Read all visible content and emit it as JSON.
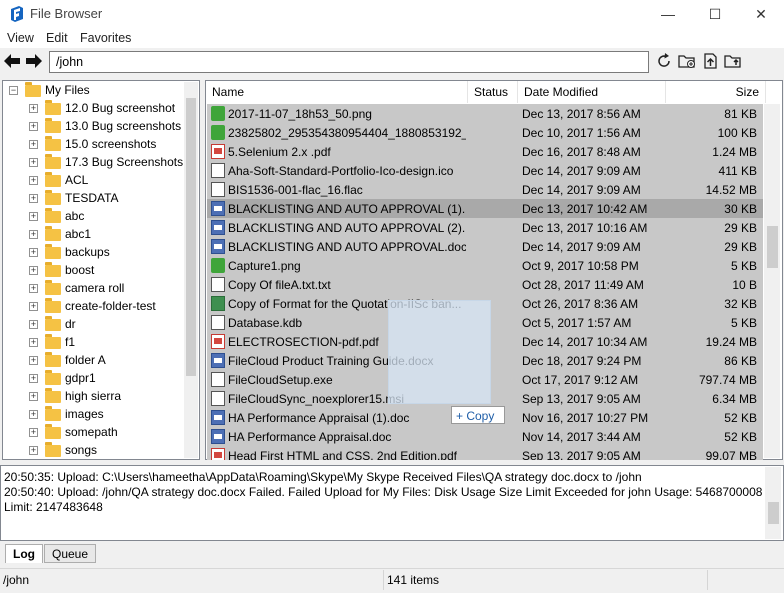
{
  "window": {
    "title": "File Browser",
    "minimize": "—",
    "maximize": "☐",
    "close": "✕"
  },
  "menu": [
    "View",
    "Edit",
    "Favorites"
  ],
  "toolbar": {
    "path_value": "/john",
    "back": "🡐",
    "forward": "🡒"
  },
  "tree": {
    "root": "My Files",
    "items": [
      "12.0 Bug screenshot",
      "13.0 Bug screenshots",
      "15.0 screenshots",
      "17.3 Bug Screenshots",
      "ACL",
      "TESDATA",
      "abc",
      "abc1",
      "backups",
      "boost",
      "camera roll",
      "create-folder-test",
      "dr",
      "f1",
      "folder A",
      "gdpr1",
      "high sierra",
      "images",
      "somepath",
      "songs"
    ]
  },
  "columns": {
    "name": "Name",
    "status": "Status",
    "date": "Date Modified",
    "size": "Size"
  },
  "files": [
    {
      "icon": "image-file-icon",
      "kind": "img",
      "name": "2017-11-07_18h53_50.png",
      "date": "Dec 13, 2017 8:56 AM",
      "size": "81 KB"
    },
    {
      "icon": "image-file-icon",
      "kind": "img",
      "name": "23825802_295354380954404_1880853192_o....",
      "date": "Dec 10, 2017 1:56 AM",
      "size": "100 KB"
    },
    {
      "icon": "pdf-file-icon",
      "kind": "pdf",
      "name": "5.Selenium 2.x .pdf",
      "date": "Dec 16, 2017 8:48 AM",
      "size": "1.24 MB"
    },
    {
      "icon": "generic-file-icon",
      "kind": "gen",
      "name": "Aha-Soft-Standard-Portfolio-Ico-design.ico",
      "date": "Dec 14, 2017 9:09 AM",
      "size": "411 KB"
    },
    {
      "icon": "generic-file-icon",
      "kind": "gen",
      "name": "BIS1536-001-flac_16.flac",
      "date": "Dec 14, 2017 9:09 AM",
      "size": "14.52 MB"
    },
    {
      "icon": "word-file-icon",
      "kind": "doc",
      "name": "BLACKLISTING AND AUTO APPROVAL (1)....",
      "date": "Dec 13, 2017 10:42 AM",
      "size": "30 KB",
      "selected": true
    },
    {
      "icon": "word-file-icon",
      "kind": "doc",
      "name": "BLACKLISTING AND AUTO APPROVAL (2)....",
      "date": "Dec 13, 2017 10:16 AM",
      "size": "29 KB"
    },
    {
      "icon": "word-file-icon",
      "kind": "doc",
      "name": "BLACKLISTING AND AUTO APPROVAL.docx",
      "date": "Dec 14, 2017 9:09 AM",
      "size": "29 KB"
    },
    {
      "icon": "image-file-icon",
      "kind": "img",
      "name": "Capture1.png",
      "date": "Oct 9, 2017 10:58 PM",
      "size": "5 KB"
    },
    {
      "icon": "generic-file-icon",
      "kind": "gen",
      "name": "Copy Of fileA.txt.txt",
      "date": "Oct 28, 2017 11:49 AM",
      "size": "10 B"
    },
    {
      "icon": "excel-file-icon",
      "kind": "xls",
      "name": "Copy of Format for the Quotation-IISc ban...",
      "date": "Oct 26, 2017 8:36 AM",
      "size": "32 KB"
    },
    {
      "icon": "generic-file-icon",
      "kind": "gen",
      "name": "Database.kdb",
      "date": "Oct 5, 2017 1:57 AM",
      "size": "5 KB"
    },
    {
      "icon": "pdf-file-icon",
      "kind": "pdf",
      "name": "ELECTROSECTION-pdf.pdf",
      "date": "Dec 14, 2017 10:34 AM",
      "size": "19.24 MB"
    },
    {
      "icon": "word-file-icon",
      "kind": "doc",
      "name": "FileCloud Product Training Guide.docx",
      "date": "Dec 18, 2017 9:24 PM",
      "size": "86 KB"
    },
    {
      "icon": "generic-file-icon",
      "kind": "gen",
      "name": "FileCloudSetup.exe",
      "date": "Oct 17, 2017 9:12 AM",
      "size": "797.74 MB"
    },
    {
      "icon": "generic-file-icon",
      "kind": "gen",
      "name": "FileCloudSync_noexplorer15.msi",
      "date": "Sep 13, 2017 9:05 AM",
      "size": "6.34 MB"
    },
    {
      "icon": "word-file-icon",
      "kind": "doc",
      "name": "HA Performance Appraisal (1).doc",
      "date": "Nov 16, 2017 10:27 PM",
      "size": "52 KB"
    },
    {
      "icon": "word-file-icon",
      "kind": "doc",
      "name": "HA Performance Appraisal.doc",
      "date": "Nov 14, 2017 3:44 AM",
      "size": "52 KB"
    },
    {
      "icon": "pdf-file-icon",
      "kind": "pdf",
      "name": "Head First HTML and CSS. 2nd Edition.pdf",
      "date": "Sep 13, 2017 9:05 AM",
      "size": "99.07 MB"
    }
  ],
  "drag": {
    "tooltip": "+ Copy"
  },
  "log": {
    "lines": [
      "20:50:35: Upload: C:\\Users\\hameetha\\AppData\\Roaming\\Skype\\My Skype Received Files\\QA strategy doc.docx to /john",
      "20:50:40: Upload: /john/QA strategy doc.docx Failed. Failed Upload for My Files: Disk Usage Size Limit Exceeded for john Usage: 5468700008",
      "Limit: 2147483648"
    ]
  },
  "tabs": {
    "log": "Log",
    "queue": "Queue"
  },
  "status": {
    "path": "/john",
    "count": "141 items"
  }
}
